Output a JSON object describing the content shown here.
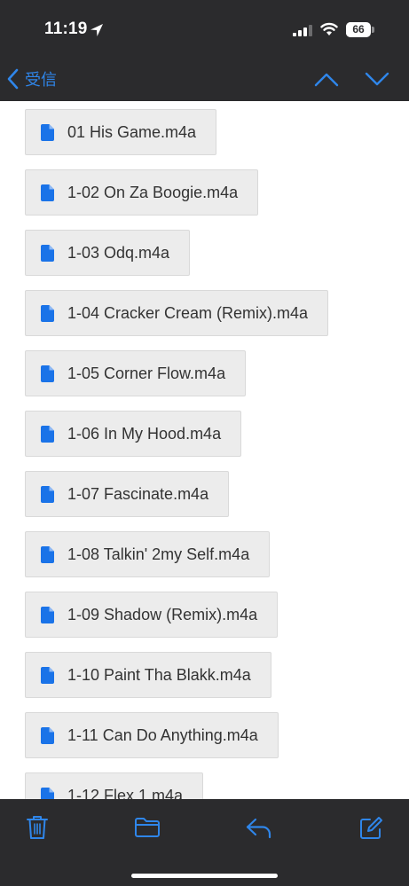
{
  "status_bar": {
    "time": "11:19",
    "battery": "66",
    "battery_level": 0.66
  },
  "nav": {
    "back_label": "受信"
  },
  "attachments": [
    "01 His Game.m4a",
    "1-02 On Za Boogie.m4a",
    "1-03 Odq.m4a",
    "1-04 Cracker Cream (Remix).m4a",
    "1-05 Corner Flow.m4a",
    "1-06 In My Hood.m4a",
    "1-07 Fascinate.m4a",
    "1-08 Talkin' 2my Self.m4a",
    "1-09 Shadow (Remix).m4a",
    "1-10 Paint Tha Blakk.m4a",
    "1-11 Can Do Anything.m4a",
    "1-12 Flex 1.m4a"
  ],
  "colors": {
    "accent": "#2f86ea",
    "bar_background": "#2b2b2d",
    "attachment_background": "#ececec",
    "file_icon": "#1a73e8"
  },
  "icons": {
    "toolbar": [
      "trash-icon",
      "folder-icon",
      "reply-icon",
      "compose-icon"
    ]
  }
}
